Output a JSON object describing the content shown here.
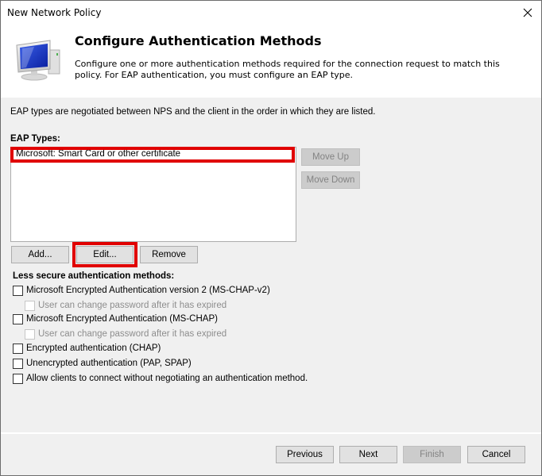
{
  "window": {
    "title": "New Network Policy",
    "close_label": "close"
  },
  "header": {
    "icon": "computer-monitor-icon",
    "title": "Configure Authentication Methods",
    "description": "Configure one or more authentication methods required for the connection request to match this policy. For EAP authentication, you must configure an EAP type."
  },
  "content": {
    "intro": "EAP types are negotiated between NPS and the client in the order in which they are listed.",
    "eap_types_label": "EAP Types:",
    "eap_types": [
      {
        "label": "Microsoft: Smart Card or other certificate",
        "highlighted": true
      }
    ],
    "move_up_label": "Move Up",
    "move_down_label": "Move Down",
    "add_label": "Add...",
    "edit_label": "Edit...",
    "remove_label": "Remove",
    "less_secure_label": "Less secure authentication methods:",
    "methods": [
      {
        "label": "Microsoft Encrypted Authentication version 2 (MS-CHAP-v2)",
        "checked": false,
        "enabled": true
      },
      {
        "label": "User can change password after it has expired",
        "checked": false,
        "enabled": false
      },
      {
        "label": "Microsoft Encrypted Authentication (MS-CHAP)",
        "checked": false,
        "enabled": true
      },
      {
        "label": "User can change password after it has expired",
        "checked": false,
        "enabled": false
      },
      {
        "label": "Encrypted authentication (CHAP)",
        "checked": false,
        "enabled": true
      },
      {
        "label": "Unencrypted authentication (PAP, SPAP)",
        "checked": false,
        "enabled": true
      },
      {
        "label": "Allow clients to connect without negotiating an authentication method.",
        "checked": false,
        "enabled": true
      }
    ]
  },
  "footer": {
    "previous_label": "Previous",
    "next_label": "Next",
    "finish_label": "Finish",
    "cancel_label": "Cancel"
  },
  "colors": {
    "highlight": "#e00000",
    "header_bg": "#ffffff",
    "body_bg": "#f0f0f0"
  }
}
